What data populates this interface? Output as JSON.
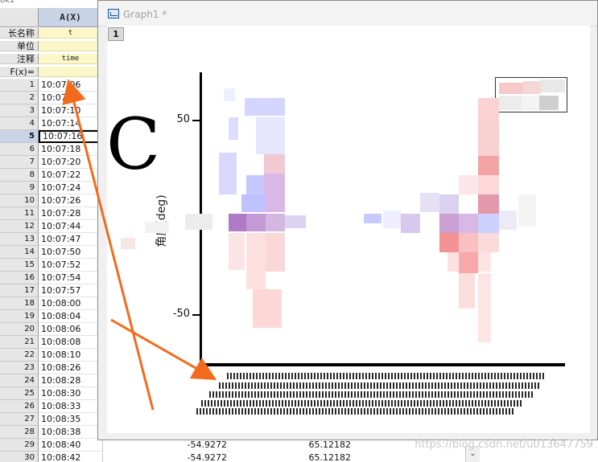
{
  "worksheet": {
    "title": "ok1",
    "column_a_header": "A(X)",
    "meta_rows": [
      {
        "label": "长名称",
        "value": "t"
      },
      {
        "label": "单位",
        "value": ""
      },
      {
        "label": "注释",
        "value": "time"
      },
      {
        "label": "F(x)=",
        "value": ""
      }
    ],
    "rows": [
      {
        "n": "1",
        "a": "10:07:06"
      },
      {
        "n": "2",
        "a": "10:07:08"
      },
      {
        "n": "3",
        "a": "10:07:10"
      },
      {
        "n": "4",
        "a": "10:07:14"
      },
      {
        "n": "5",
        "a": "10:07:16"
      },
      {
        "n": "6",
        "a": "10:07:18"
      },
      {
        "n": "7",
        "a": "10:07:20"
      },
      {
        "n": "8",
        "a": "10:07:22"
      },
      {
        "n": "9",
        "a": "10:07:24"
      },
      {
        "n": "10",
        "a": "10:07:26"
      },
      {
        "n": "11",
        "a": "10:07:28"
      },
      {
        "n": "12",
        "a": "10:07:44"
      },
      {
        "n": "13",
        "a": "10:07:47"
      },
      {
        "n": "14",
        "a": "10:07:50"
      },
      {
        "n": "15",
        "a": "10:07:52"
      },
      {
        "n": "16",
        "a": "10:07:54"
      },
      {
        "n": "17",
        "a": "10:07:57"
      },
      {
        "n": "18",
        "a": "10:08:00"
      },
      {
        "n": "19",
        "a": "10:08:04"
      },
      {
        "n": "20",
        "a": "10:08:06"
      },
      {
        "n": "21",
        "a": "10:08:08"
      },
      {
        "n": "22",
        "a": "10:08:10"
      },
      {
        "n": "23",
        "a": "10:08:26"
      },
      {
        "n": "24",
        "a": "10:08:28"
      },
      {
        "n": "25",
        "a": "10:08:30"
      },
      {
        "n": "26",
        "a": "10:08:33"
      },
      {
        "n": "27",
        "a": "10:08:35"
      },
      {
        "n": "28",
        "a": "10:08:38"
      },
      {
        "n": "29",
        "a": "10:08:40",
        "b": "-54.9272",
        "c": "65.12182"
      },
      {
        "n": "30",
        "a": "10:08:42",
        "b": "-54.9272",
        "c": "65.12182"
      }
    ],
    "selected_row": "5",
    "scroll_arrow": "⌄"
  },
  "graph": {
    "window_title": "Graph1 *",
    "layer_label": "1",
    "annotation_letter": "C",
    "y_axis_label": "角度(deg)",
    "y_ticks": [
      {
        "label": "50",
        "value": 50
      },
      {
        "label": "-50",
        "value": -50
      }
    ],
    "y_range": [
      -75,
      75
    ]
  },
  "watermark": "https://blog.csdn.net/u013647759",
  "colors": {
    "arrow": "#f26b1d",
    "selected_header": "#c9d3e6",
    "meta_fill": "#fbf7c8"
  }
}
